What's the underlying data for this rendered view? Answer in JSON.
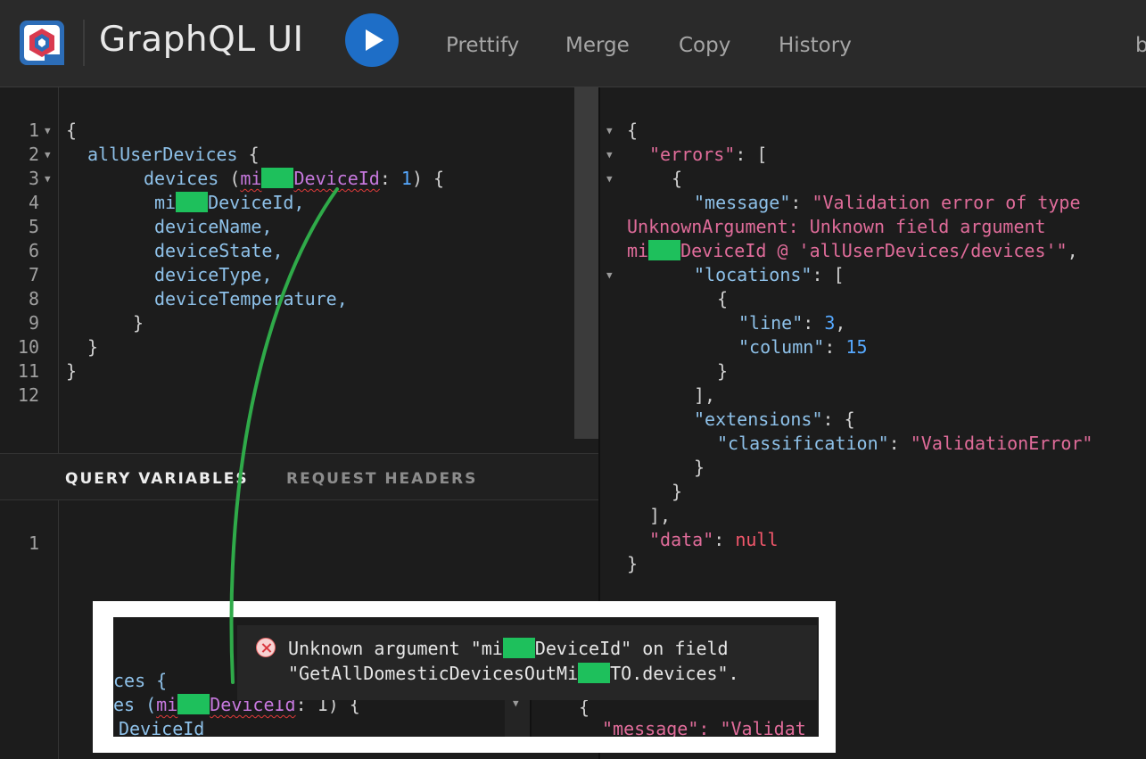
{
  "app": {
    "title": "GraphQL UI"
  },
  "toolbar": {
    "prettify": "Prettify",
    "merge": "Merge",
    "copy": "Copy",
    "history": "History",
    "cut_label": "b"
  },
  "colors": {
    "accent": "#1e6ec7",
    "redaction": "#1ec05c",
    "annotation": "#2faa49",
    "error": "#d9363e"
  },
  "icons": {
    "logo": "graphql-logo-icon",
    "run": "play-icon",
    "error": "error-x-icon",
    "fold": "fold-arrow-icon"
  },
  "query": {
    "line_numbers": [
      "1",
      "2",
      "3",
      "4",
      "5",
      "6",
      "7",
      "8",
      "9",
      "10",
      "11",
      "12"
    ],
    "brace_open": "{",
    "field_all": "allUserDevices",
    "devices": "devices",
    "paren_open": " (",
    "arg_prefix": "mi",
    "arg_suffix": "DeviceId",
    "colon": ": ",
    "arg_value": "1",
    "paren_close": ") {",
    "f1_prefix": "mi",
    "f1_suffix": "DeviceId,",
    "f2": "deviceName,",
    "f3": "deviceState,",
    "f4": "deviceType,",
    "f5": "deviceTemperature,",
    "close_inner": "}",
    "close_mid": "}",
    "close_outer": "}",
    "space_brace": " {"
  },
  "variables": {
    "tab_query": "QUERY VARIABLES",
    "tab_headers": "REQUEST HEADERS",
    "line_numbers": [
      "1"
    ]
  },
  "result": {
    "l1": "{",
    "k_errors": "\"errors\"",
    "t_errors": ": [",
    "l3": "{",
    "k_message": "\"message\"",
    "colon": ": ",
    "msg_1": "\"Validation error of type",
    "msg_2": "UnknownArgument: Unknown field argument",
    "msg_3_prefix": "mi",
    "msg_3_suffix": "DeviceId @ 'allUserDevices/devices'\"",
    "comma": ",",
    "k_locations": "\"locations\"",
    "t_locations": ": [",
    "l8": "{",
    "k_line": "\"line\"",
    "v_line": "3",
    "k_column": "\"column\"",
    "v_column": "15",
    "l11": "}",
    "l12": "],",
    "k_extensions": "\"extensions\"",
    "t_extensions": ": {",
    "k_class": "\"classification\"",
    "v_class": "\"ValidationError\"",
    "l15": "}",
    "l16": "}",
    "l17": "],",
    "k_data": "\"data\"",
    "v_data": "null",
    "l19": "}"
  },
  "tooltip": {
    "line1_a": "Unknown argument \"mi",
    "line1_b": "DeviceId\" on field",
    "line2_a": "\"GetAllDomesticDevicesOutMi",
    "line2_b": "TO.devices\".",
    "snip1": "ces {",
    "snip2_a": "es (",
    "snip2_b": "mi",
    "snip2_c": "DeviceId",
    "snip2_d": ": 1) {",
    "snip3": "DeviceId",
    "snip_right1": "{",
    "snip_right2": "\"message\": \"Validat"
  }
}
